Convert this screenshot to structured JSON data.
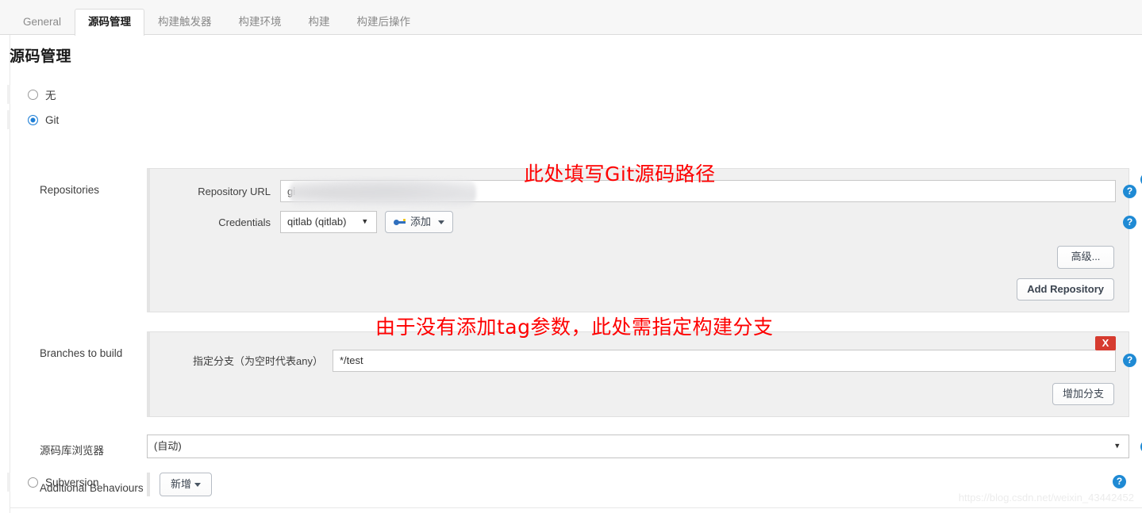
{
  "tabs": [
    {
      "label": "General",
      "active": false
    },
    {
      "label": "源码管理",
      "active": true
    },
    {
      "label": "构建触发器",
      "active": false
    },
    {
      "label": "构建环境",
      "active": false
    },
    {
      "label": "构建",
      "active": false
    },
    {
      "label": "构建后操作",
      "active": false
    }
  ],
  "page": {
    "title": "源码管理"
  },
  "scm": {
    "options": [
      {
        "label": "无",
        "selected": false
      },
      {
        "label": "Git",
        "selected": true
      },
      {
        "label": "Subversion",
        "selected": false
      }
    ]
  },
  "repositories": {
    "row_label": "Repositories",
    "url_label": "Repository URL",
    "url_value": "gi",
    "url_redacted": true,
    "credentials_label": "Credentials",
    "credentials_value": "qitlab (qitlab)",
    "add_credentials_label": "添加",
    "advanced_label": "高级...",
    "add_repository_label": "Add Repository",
    "help_label": "?"
  },
  "branches": {
    "row_label": "Branches to build",
    "branch_label": "指定分支（为空时代表any）",
    "branch_value": "*/test",
    "delete_label": "X",
    "add_branch_label": "增加分支",
    "help_label": "?"
  },
  "browser": {
    "row_label": "源码库浏览器",
    "value": "(自动)",
    "help_label": "?"
  },
  "behaviours": {
    "row_label": "Additional Behaviours",
    "add_label": "新增"
  },
  "annotations": [
    {
      "text": "此处填写Git源码路径",
      "color": "#fe0000"
    },
    {
      "text": "由于没有添加tag参数，此处需指定构建分支",
      "color": "#fe0000"
    }
  ],
  "watermark": "https://blog.csdn.net/weixin_43442452",
  "colors": {
    "accent": "#1f8ad4",
    "radio_selected": "#1f7fd6",
    "delete": "#d63b2f",
    "annotation": "#fe0000"
  }
}
